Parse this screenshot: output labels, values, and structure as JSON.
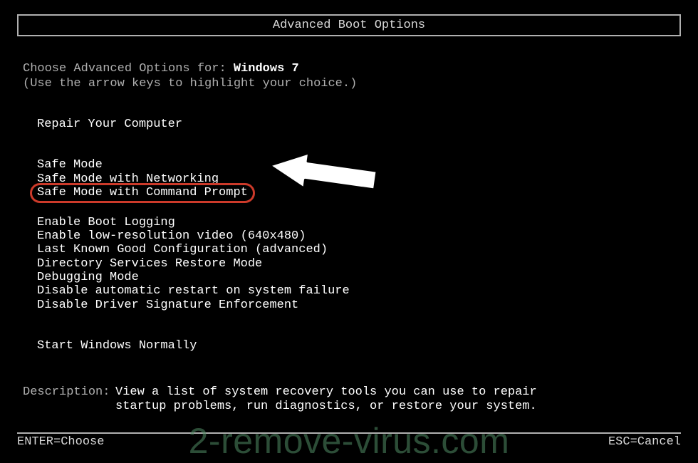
{
  "title": "Advanced Boot Options",
  "prompt_prefix": "Choose Advanced Options for: ",
  "os_name": "Windows 7",
  "hint": "(Use the arrow keys to highlight your choice.)",
  "groups": {
    "repair": [
      "Repair Your Computer"
    ],
    "safe": [
      "Safe Mode",
      "Safe Mode with Networking",
      "Safe Mode with Command Prompt"
    ],
    "advanced": [
      "Enable Boot Logging",
      "Enable low-resolution video (640x480)",
      "Last Known Good Configuration (advanced)",
      "Directory Services Restore Mode",
      "Debugging Mode",
      "Disable automatic restart on system failure",
      "Disable Driver Signature Enforcement"
    ],
    "normal": [
      "Start Windows Normally"
    ]
  },
  "description": {
    "label": "Description:",
    "text": "View a list of system recovery tools you can use to repair startup problems, run diagnostics, or restore your system."
  },
  "footer": {
    "enter": "ENTER=Choose",
    "esc": "ESC=Cancel"
  },
  "watermark": "2-remove-virus.com"
}
